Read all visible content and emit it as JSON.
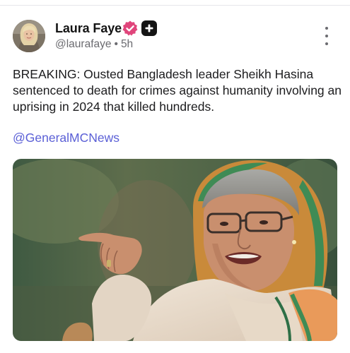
{
  "post": {
    "author": {
      "display_name": "Laura Faye",
      "handle": "@laurafaye",
      "separator": "•",
      "time_ago": "5h",
      "verified_icon": "verified-badge-icon",
      "subscriber_icon": "plus-badge-icon"
    },
    "text": "BREAKING: Ousted Bangladesh leader Sheikh Hasina sentenced to death for crimes against humanity involving an uprising in 2024 that killed hundreds.",
    "mention": "@GeneralMCNews",
    "menu_icon": "more-vertical-icon"
  },
  "colors": {
    "verified": "#e0457b",
    "mention": "#5a5fd6",
    "text": "#1c1c1e",
    "secondary": "#6b6b70"
  }
}
